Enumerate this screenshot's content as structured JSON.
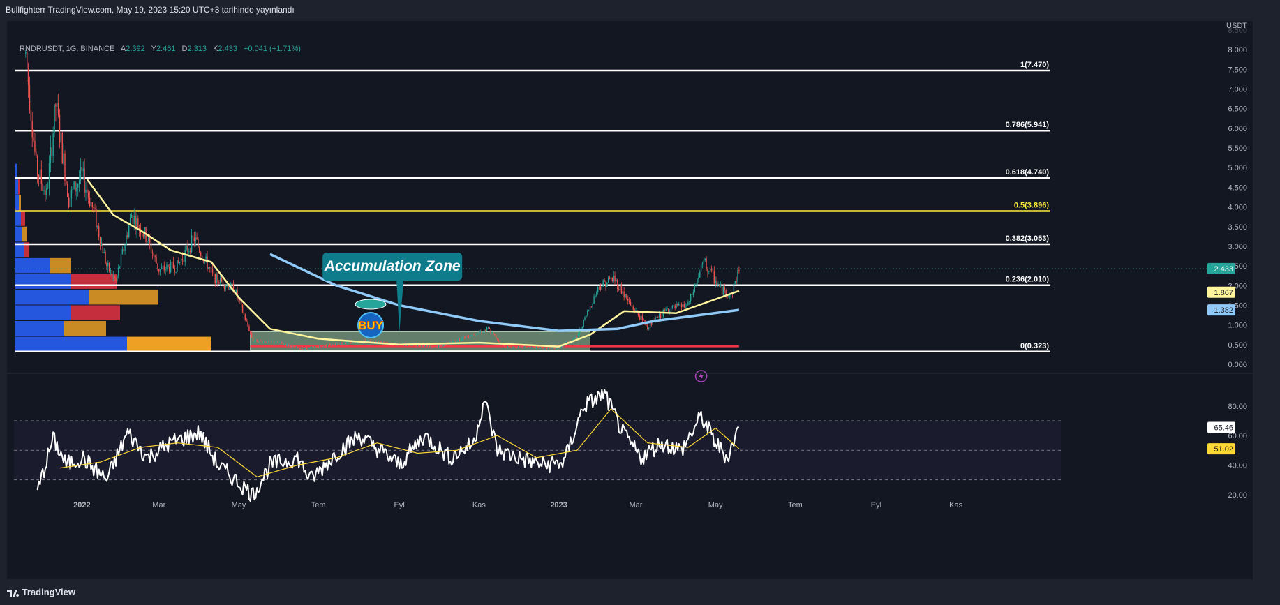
{
  "header": {
    "published": "Bullfighterr TradingView.com, May 19, 2023 15:20 UTC+3 tarihinde yayınlandı"
  },
  "legend": {
    "symbol": "RNDRUSDT, 1G, BINANCE",
    "open_label": "A",
    "open": "2.392",
    "high_label": "Y",
    "high": "2.461",
    "low_label": "D",
    "low": "2.313",
    "close_label": "K",
    "close": "2.433",
    "change": "+0.041 (+1.71%)"
  },
  "price_axis": {
    "currency": "USDT",
    "ticks": [
      "0.000",
      "0.500",
      "1.000",
      "1.500",
      "2.000",
      "2.500",
      "3.000",
      "3.500",
      "4.000",
      "4.500",
      "5.000",
      "5.500",
      "6.000",
      "6.500",
      "7.000",
      "7.500",
      "8.000",
      "8.500"
    ]
  },
  "rsi_axis": {
    "ticks": [
      "20.00",
      "40.00",
      "60.00",
      "80.00"
    ]
  },
  "time_axis": {
    "labels": [
      "2022",
      "Mar",
      "May",
      "Tem",
      "Eyl",
      "Kas",
      "2023",
      "Mar",
      "May",
      "Tem",
      "Eyl",
      "Kas"
    ]
  },
  "price_tags": {
    "last": "2.433",
    "ma_short": "1.867",
    "ma_long": "1.382",
    "rsi": "65.46",
    "rsi_ma": "51.02"
  },
  "annotations": {
    "accumulation": "Accumulation Zone",
    "buy": "BUY"
  },
  "footer": {
    "brand": "TradingView"
  },
  "colors": {
    "background": "#131722",
    "up": "#26a69a",
    "down": "#ef5350",
    "fib": "#ffffff",
    "fib_half": "#ffeb3b",
    "ma_short": "#fff59d",
    "ma_long": "#90caf9",
    "callout": "#0f7c8c",
    "support": "#f23645",
    "vp_up": "#2962ff",
    "vp_down": "#f23645",
    "vp_poc": "#f9a825"
  },
  "chart_data": {
    "type": "candlestick",
    "symbol": "RNDRUSDT",
    "interval": "1G",
    "exchange": "BINANCE",
    "ylim": [
      0,
      8.5
    ],
    "y_scale": "linear",
    "grid": false,
    "fib_levels": [
      {
        "ratio": "0",
        "price": 0.323,
        "label": "0(0.323)"
      },
      {
        "ratio": "0.236",
        "price": 2.01,
        "label": "0.236(2.010)"
      },
      {
        "ratio": "0.382",
        "price": 3.053,
        "label": "0.382(3.053)"
      },
      {
        "ratio": "0.5",
        "price": 3.896,
        "label": "0.5(3.896)"
      },
      {
        "ratio": "0.618",
        "price": 4.74,
        "label": "0.618(4.740)"
      },
      {
        "ratio": "0.786",
        "price": 5.941,
        "label": "0.786(5.941)"
      },
      {
        "ratio": "1",
        "price": 7.47,
        "label": "1(7.470)"
      }
    ],
    "support_line": 0.46,
    "accumulation_zone": {
      "from": "2022-05-10",
      "to": "2023-01-25",
      "low": 0.35,
      "high": 0.83
    },
    "price_path": [
      [
        "2021-11-19",
        7.9
      ],
      [
        "2021-11-27",
        5.0
      ],
      [
        "2021-12-05",
        4.3
      ],
      [
        "2021-12-12",
        6.6
      ],
      [
        "2021-12-22",
        4.2
      ],
      [
        "2022-01-01",
        4.8
      ],
      [
        "2022-01-10",
        3.9
      ],
      [
        "2022-01-20",
        2.5
      ],
      [
        "2022-01-27",
        2.1
      ],
      [
        "2022-02-08",
        3.8
      ],
      [
        "2022-02-20",
        3.2
      ],
      [
        "2022-03-01",
        2.4
      ],
      [
        "2022-03-15",
        2.5
      ],
      [
        "2022-03-28",
        3.2
      ],
      [
        "2022-04-12",
        2.2
      ],
      [
        "2022-04-28",
        1.9
      ],
      [
        "2022-05-12",
        0.6
      ],
      [
        "2022-06-01",
        0.55
      ],
      [
        "2022-06-18",
        0.38
      ],
      [
        "2022-07-10",
        0.5
      ],
      [
        "2022-08-05",
        0.6
      ],
      [
        "2022-09-01",
        0.5
      ],
      [
        "2022-10-01",
        0.45
      ],
      [
        "2022-11-08",
        0.9
      ],
      [
        "2022-11-20",
        0.45
      ],
      [
        "2022-12-31",
        0.4
      ],
      [
        "2023-01-15",
        0.7
      ],
      [
        "2023-02-01",
        2.0
      ],
      [
        "2023-02-12",
        2.2
      ],
      [
        "2023-02-25",
        1.5
      ],
      [
        "2023-03-10",
        0.95
      ],
      [
        "2023-03-25",
        1.4
      ],
      [
        "2023-04-10",
        1.5
      ],
      [
        "2023-04-22",
        2.6
      ],
      [
        "2023-05-05",
        1.9
      ],
      [
        "2023-05-13",
        1.75
      ],
      [
        "2023-05-19",
        2.433
      ]
    ],
    "ma_short_path": [
      [
        "2022-01-05",
        4.7
      ],
      [
        "2022-01-25",
        3.8
      ],
      [
        "2022-02-15",
        3.4
      ],
      [
        "2022-03-10",
        2.9
      ],
      [
        "2022-04-10",
        2.6
      ],
      [
        "2022-05-01",
        1.7
      ],
      [
        "2022-05-25",
        0.9
      ],
      [
        "2022-07-01",
        0.65
      ],
      [
        "2022-09-01",
        0.5
      ],
      [
        "2022-11-01",
        0.55
      ],
      [
        "2023-01-01",
        0.45
      ],
      [
        "2023-01-25",
        0.75
      ],
      [
        "2023-02-20",
        1.35
      ],
      [
        "2023-04-01",
        1.3
      ],
      [
        "2023-05-19",
        1.867
      ]
    ],
    "ma_long_path": [
      [
        "2022-05-25",
        2.8
      ],
      [
        "2022-07-15",
        2.0
      ],
      [
        "2022-09-01",
        1.5
      ],
      [
        "2022-11-01",
        1.1
      ],
      [
        "2023-01-01",
        0.85
      ],
      [
        "2023-02-15",
        0.9
      ],
      [
        "2023-03-15",
        1.1
      ],
      [
        "2023-05-19",
        1.382
      ]
    ],
    "volume_profile": [
      {
        "price_from": 0.32,
        "price_to": 0.7,
        "up": 160,
        "down": 120
      },
      {
        "price_from": 0.7,
        "price_to": 1.1,
        "up": 70,
        "down": 60
      },
      {
        "price_from": 1.1,
        "price_to": 1.5,
        "up": 80,
        "down": 70
      },
      {
        "price_from": 1.5,
        "price_to": 1.9,
        "up": 105,
        "down": 100
      },
      {
        "price_from": 1.9,
        "price_to": 2.3,
        "up": 80,
        "down": 65
      },
      {
        "price_from": 2.3,
        "price_to": 2.7,
        "up": 50,
        "down": 30
      },
      {
        "price_from": 2.7,
        "price_to": 3.1,
        "up": 12,
        "down": 8
      },
      {
        "price_from": 3.1,
        "price_to": 3.5,
        "up": 10,
        "down": 6
      },
      {
        "price_from": 3.5,
        "price_to": 3.9,
        "up": 8,
        "down": 6
      },
      {
        "price_from": 3.9,
        "price_to": 4.3,
        "up": 5,
        "down": 3
      },
      {
        "price_from": 4.3,
        "price_to": 4.7,
        "up": 4,
        "down": 2
      },
      {
        "price_from": 4.7,
        "price_to": 5.1,
        "up": 2,
        "down": 1
      }
    ],
    "rsi": {
      "ylim": [
        10,
        95
      ],
      "levels": [
        30,
        50,
        70
      ],
      "last": 65.46,
      "ma_last": 51.02,
      "path": [
        [
          "2021-11-28",
          22
        ],
        [
          "2021-12-10",
          58
        ],
        [
          "2021-12-20",
          40
        ],
        [
          "2022-01-01",
          45
        ],
        [
          "2022-01-20",
          30
        ],
        [
          "2022-02-05",
          62
        ],
        [
          "2022-02-20",
          45
        ],
        [
          "2022-03-10",
          55
        ],
        [
          "2022-04-01",
          62
        ],
        [
          "2022-04-15",
          40
        ],
        [
          "2022-05-01",
          28
        ],
        [
          "2022-05-12",
          20
        ],
        [
          "2022-05-25",
          40
        ],
        [
          "2022-06-15",
          45
        ],
        [
          "2022-06-25",
          30
        ],
        [
          "2022-07-15",
          48
        ],
        [
          "2022-08-01",
          60
        ],
        [
          "2022-08-20",
          48
        ],
        [
          "2022-09-01",
          40
        ],
        [
          "2022-09-20",
          60
        ],
        [
          "2022-10-10",
          45
        ],
        [
          "2022-10-28",
          55
        ],
        [
          "2022-11-05",
          85
        ],
        [
          "2022-11-15",
          50
        ],
        [
          "2022-12-01",
          45
        ],
        [
          "2022-12-20",
          40
        ],
        [
          "2023-01-05",
          42
        ],
        [
          "2023-01-20",
          80
        ],
        [
          "2023-02-05",
          88
        ],
        [
          "2023-02-20",
          60
        ],
        [
          "2023-03-05",
          45
        ],
        [
          "2023-03-20",
          55
        ],
        [
          "2023-04-05",
          50
        ],
        [
          "2023-04-20",
          73
        ],
        [
          "2023-05-01",
          55
        ],
        [
          "2023-05-10",
          45
        ],
        [
          "2023-05-19",
          65.46
        ]
      ],
      "ma_path": [
        [
          "2021-12-15",
          38
        ],
        [
          "2022-01-15",
          42
        ],
        [
          "2022-02-15",
          52
        ],
        [
          "2022-03-15",
          55
        ],
        [
          "2022-04-15",
          52
        ],
        [
          "2022-05-15",
          32
        ],
        [
          "2022-06-15",
          40
        ],
        [
          "2022-07-15",
          45
        ],
        [
          "2022-08-15",
          55
        ],
        [
          "2022-09-15",
          48
        ],
        [
          "2022-10-15",
          50
        ],
        [
          "2022-11-15",
          60
        ],
        [
          "2022-12-15",
          45
        ],
        [
          "2023-01-15",
          50
        ],
        [
          "2023-02-10",
          78
        ],
        [
          "2023-03-10",
          55
        ],
        [
          "2023-04-10",
          52
        ],
        [
          "2023-05-01",
          65
        ],
        [
          "2023-05-19",
          51.02
        ]
      ]
    }
  }
}
